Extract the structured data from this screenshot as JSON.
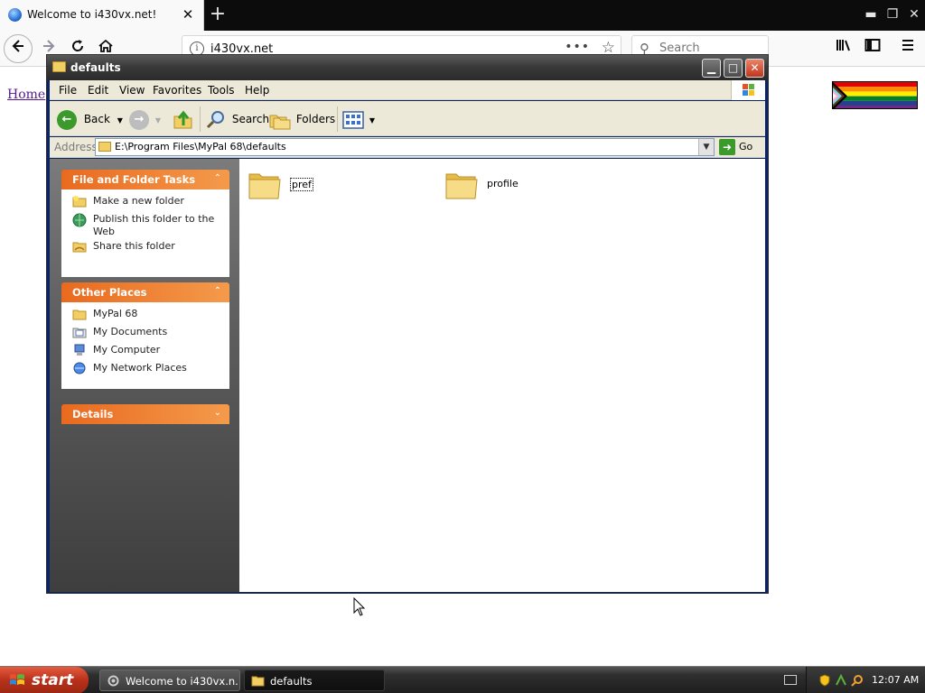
{
  "browser": {
    "tab_title": "Welcome to i430vx.net!",
    "tab_close": "✕",
    "new_tab": "+",
    "url": "i430vx.net",
    "search_placeholder": "Search",
    "window_controls": {
      "minimize": "▬",
      "restore": "❐",
      "close": "✕"
    },
    "nav_icons": {
      "back": "back-arrow-icon",
      "forward": "forward-arrow-icon",
      "reload": "reload-icon",
      "home": "home-icon"
    },
    "tools": [
      "library-icon",
      "sidebar-icon",
      "menu-icon"
    ]
  },
  "page": {
    "home_link": "Home"
  },
  "explorer": {
    "title": "defaults",
    "menu": [
      "File",
      "Edit",
      "View",
      "Favorites",
      "Tools",
      "Help"
    ],
    "toolbar": {
      "back": "Back",
      "search": "Search",
      "folders": "Folders"
    },
    "address_label": "Address",
    "address_value": "E:\\Program Files\\MyPal 68\\defaults",
    "go_label": "Go",
    "panels": {
      "tasks": {
        "title": "File and Folder Tasks",
        "items": [
          "Make a new folder",
          "Publish this folder to the Web",
          "Share this folder"
        ]
      },
      "places": {
        "title": "Other Places",
        "items": [
          "MyPal 68",
          "My Documents",
          "My Computer",
          "My Network Places"
        ]
      },
      "details": {
        "title": "Details"
      }
    },
    "files": [
      {
        "name": "pref",
        "selected": true
      },
      {
        "name": "profile",
        "selected": false
      }
    ]
  },
  "taskbar": {
    "start_label": "start",
    "buttons": [
      "Welcome to i430vx.n...",
      "defaults"
    ],
    "clock": "12:07 AM"
  },
  "colors": {
    "panel_header": "#e96a1f",
    "titlebar": "#3a3a3a",
    "link_visited": "#551a8b",
    "start_button": "#b8301a"
  }
}
